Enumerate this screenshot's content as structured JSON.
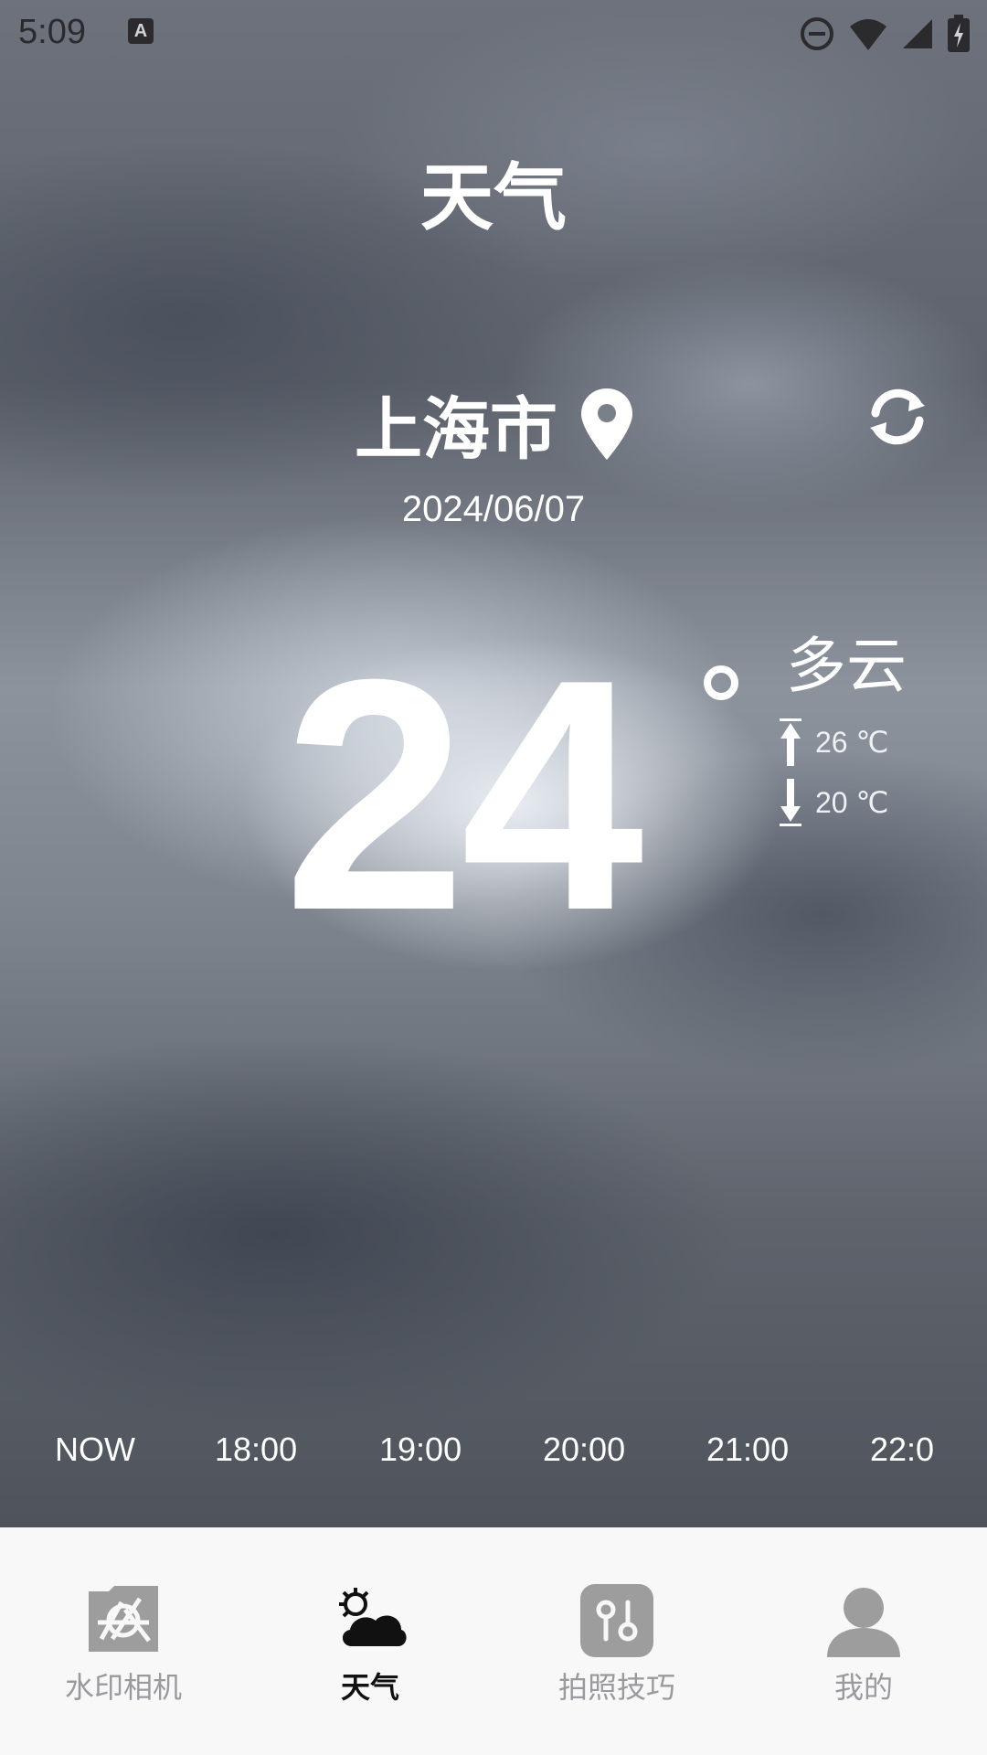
{
  "status_bar": {
    "time": "5:09",
    "a_icon": "A"
  },
  "header": {
    "title": "天气"
  },
  "location": {
    "city": "上海市",
    "date": "2024/06/07"
  },
  "weather": {
    "temperature": "24",
    "condition": "多云",
    "high": "26 ℃",
    "low": "20 ℃"
  },
  "hourly": [
    "NOW",
    "18:00",
    "19:00",
    "20:00",
    "21:00",
    "22:0"
  ],
  "nav": {
    "tabs": [
      {
        "label": "水印相机",
        "icon": "watermark-camera-icon"
      },
      {
        "label": "天气",
        "icon": "weather-icon"
      },
      {
        "label": "拍照技巧",
        "icon": "photo-tips-icon"
      },
      {
        "label": "我的",
        "icon": "profile-icon"
      }
    ]
  },
  "colors": {
    "active": "#111111",
    "inactive": "#9a9a9e",
    "icon_inactive": "#9d9d9d"
  }
}
